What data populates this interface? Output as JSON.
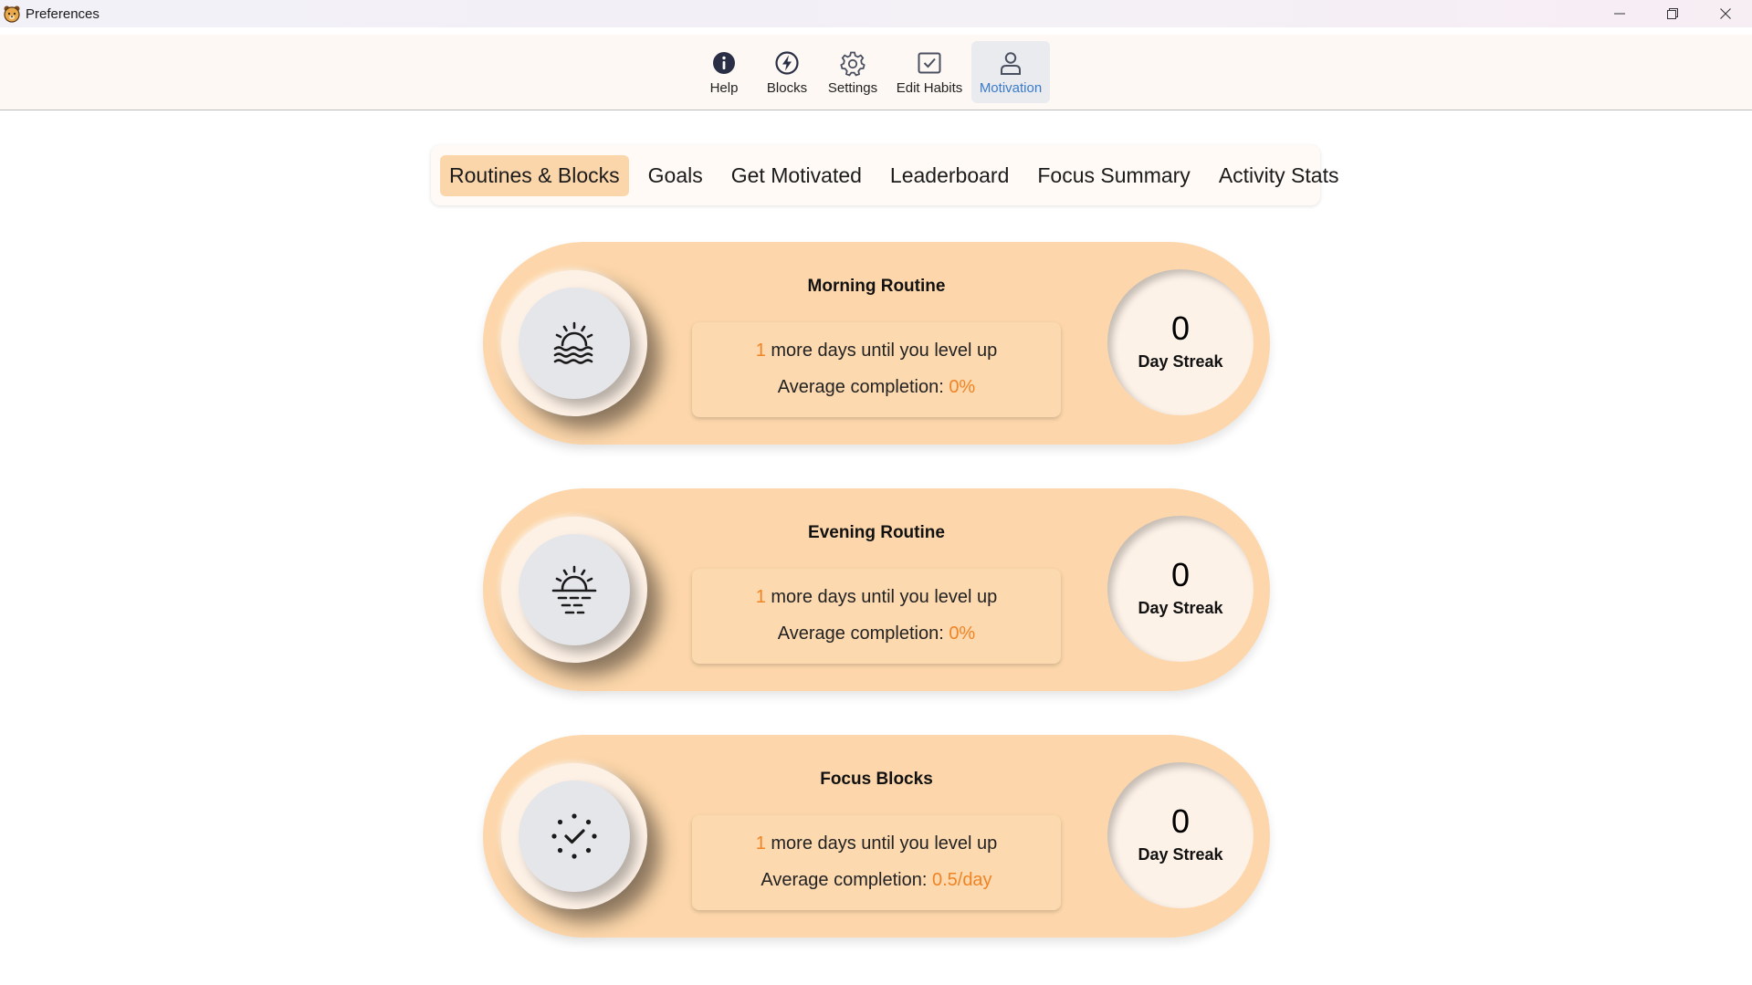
{
  "window": {
    "title": "Preferences",
    "app_icon": "bear-icon"
  },
  "toolbar": {
    "items": [
      {
        "label": "Help",
        "icon": "info-icon",
        "active": false
      },
      {
        "label": "Blocks",
        "icon": "lightning-icon",
        "active": false
      },
      {
        "label": "Settings",
        "icon": "gear-icon",
        "active": false
      },
      {
        "label": "Edit Habits",
        "icon": "checkbox-icon",
        "active": false
      },
      {
        "label": "Motivation",
        "icon": "person-icon",
        "active": true
      }
    ]
  },
  "tabs": [
    {
      "label": "Routines & Blocks",
      "active": true
    },
    {
      "label": "Goals",
      "active": false
    },
    {
      "label": "Get Motivated",
      "active": false
    },
    {
      "label": "Leaderboard",
      "active": false
    },
    {
      "label": "Focus Summary",
      "active": false
    },
    {
      "label": "Activity Stats",
      "active": false
    }
  ],
  "cards": [
    {
      "title": "Morning Routine",
      "icon": "sunrise-icon",
      "days_count": "1",
      "days_text": " more days until you level up",
      "avg_label": "Average completion: ",
      "avg_value": "0%",
      "streak_value": "0",
      "streak_label": "Day Streak"
    },
    {
      "title": "Evening Routine",
      "icon": "sunset-icon",
      "days_count": "1",
      "days_text": " more days until you level up",
      "avg_label": "Average completion: ",
      "avg_value": "0%",
      "streak_value": "0",
      "streak_label": "Day Streak"
    },
    {
      "title": "Focus Blocks",
      "icon": "focus-check-icon",
      "days_count": "1",
      "days_text": " more days until you level up",
      "avg_label": "Average completion: ",
      "avg_value": "0.5/day",
      "streak_value": "0",
      "streak_label": "Day Streak"
    }
  ],
  "colors": {
    "accent_orange": "#f08424",
    "card_bg": "#fdd7ab",
    "active_tab_bg": "#fcd6ab",
    "active_tool_label": "#3a7bc8"
  }
}
